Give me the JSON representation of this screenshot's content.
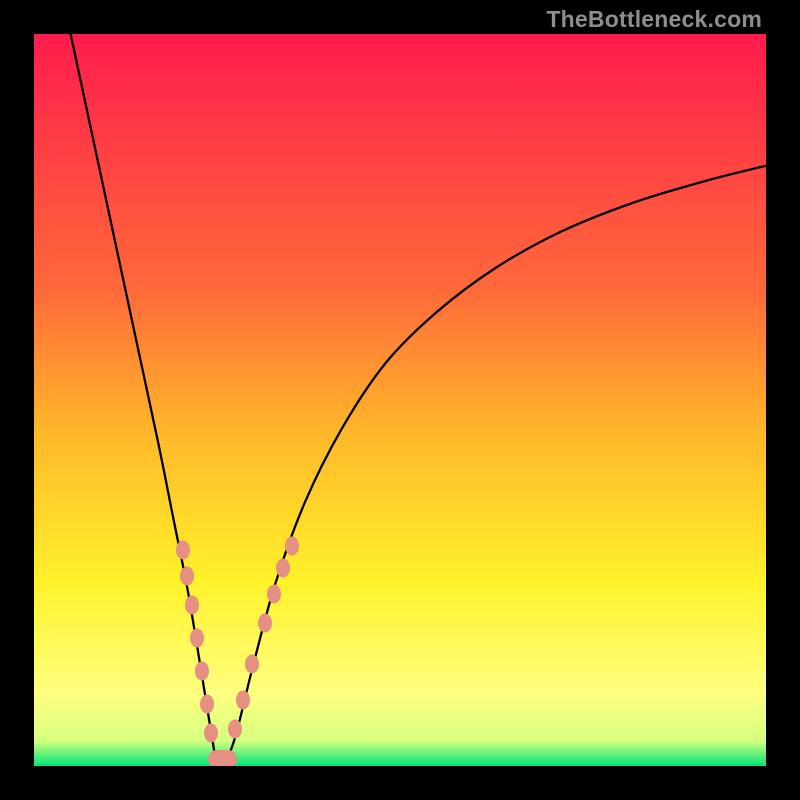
{
  "watermark_text": "TheBottleneck.com",
  "chart_data": {
    "type": "line",
    "title": "",
    "xlabel": "",
    "ylabel": "",
    "xlim": [
      0,
      100
    ],
    "ylim": [
      0,
      100
    ],
    "grid": false,
    "legend": false,
    "gradient_colors": [
      {
        "stop": 0.0,
        "hex": "#ff1c4c"
      },
      {
        "stop": 0.35,
        "hex": "#ff6a3a"
      },
      {
        "stop": 0.55,
        "hex": "#ffb92a"
      },
      {
        "stop": 0.75,
        "hex": "#fff22a"
      },
      {
        "stop": 0.9,
        "hex": "#ffff80"
      },
      {
        "stop": 0.965,
        "hex": "#d7ff80"
      },
      {
        "stop": 1.0,
        "hex": "#00e67a"
      }
    ],
    "series": [
      {
        "name": "bottleneck-curve",
        "x": [
          5,
          8,
          11,
          14,
          17,
          19,
          21,
          23,
          24.3,
          25.0,
          26.0,
          27.5,
          30,
          33,
          37,
          42,
          48,
          55,
          63,
          72,
          82,
          92,
          100
        ],
        "y": [
          100,
          86,
          72,
          58,
          44,
          34,
          24,
          12,
          4,
          0.5,
          0.5,
          4,
          14,
          25,
          36,
          46,
          55,
          62,
          68,
          73,
          77,
          80,
          82
        ]
      }
    ],
    "marker_cluster": {
      "color": "#e68f83",
      "points": [
        {
          "x": 20.3,
          "y": 29.5
        },
        {
          "x": 20.9,
          "y": 26.0
        },
        {
          "x": 21.6,
          "y": 22.0
        },
        {
          "x": 22.3,
          "y": 17.5
        },
        {
          "x": 22.9,
          "y": 13.0
        },
        {
          "x": 23.6,
          "y": 8.5
        },
        {
          "x": 24.2,
          "y": 4.5
        },
        {
          "x": 24.8,
          "y": 1.5
        },
        {
          "x": 25.7,
          "y": 1.0
        },
        {
          "x": 26.6,
          "y": 2.0
        },
        {
          "x": 27.5,
          "y": 5.0
        },
        {
          "x": 28.5,
          "y": 9.0
        },
        {
          "x": 29.8,
          "y": 14.0
        },
        {
          "x": 31.5,
          "y": 19.5
        },
        {
          "x": 32.8,
          "y": 23.5
        },
        {
          "x": 34.0,
          "y": 27.0
        },
        {
          "x": 35.2,
          "y": 30.0
        }
      ]
    }
  }
}
